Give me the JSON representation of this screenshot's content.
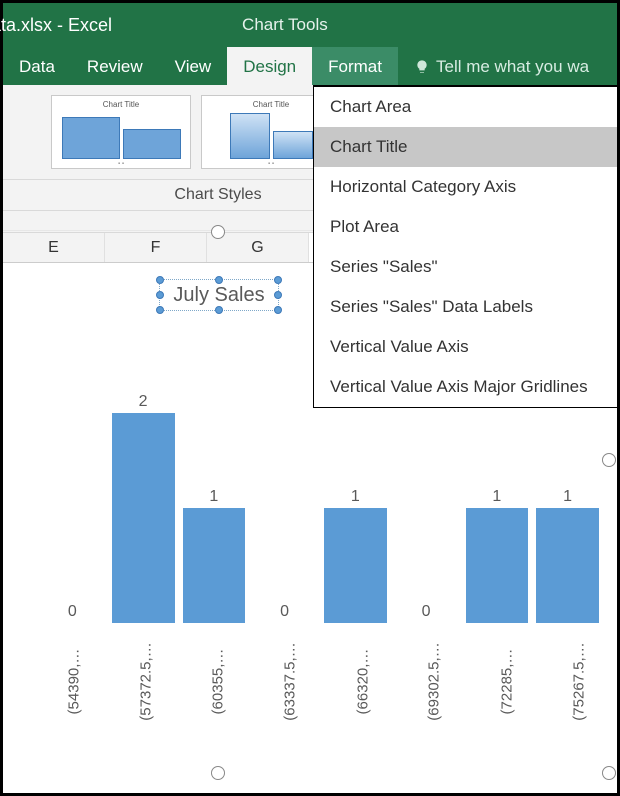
{
  "titlebar": {
    "filename": "ata.xlsx - Excel",
    "context": "Chart Tools"
  },
  "ribbon_tabs": {
    "data": "Data",
    "review": "Review",
    "view": "View",
    "design": "Design",
    "format": "Format",
    "tellme": "Tell me what you wa"
  },
  "ribbon": {
    "styles_label": "Chart Styles",
    "thumb_title": "Chart Title"
  },
  "dropdown_items": [
    "Chart Area",
    "Chart Title",
    "Horizontal Category Axis",
    "Plot Area",
    "Series \"Sales\"",
    "Series \"Sales\" Data Labels",
    "Vertical Value Axis",
    "Vertical Value Axis Major Gridlines"
  ],
  "dropdown_highlight_index": 1,
  "columns": [
    "E",
    "F",
    "G"
  ],
  "chart": {
    "title": "July Sales"
  },
  "chart_data": {
    "type": "bar",
    "title": "July Sales",
    "xlabel": "",
    "ylabel": "",
    "ylim": [
      0,
      2
    ],
    "categories": [
      "(54390,…",
      "(57372.5,…",
      "(60355,…",
      "(63337.5,…",
      "(66320,…",
      "(69302.5,…",
      "(72285,…",
      "(75267.5,…"
    ],
    "values": [
      0,
      2,
      1,
      0,
      1,
      0,
      1,
      1
    ],
    "series_name": "Sales"
  }
}
